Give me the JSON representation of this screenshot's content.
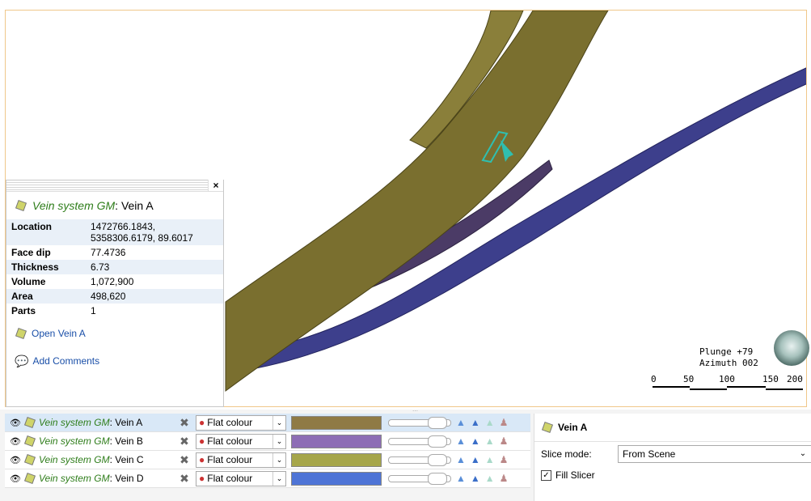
{
  "info_panel": {
    "close": "×",
    "title_italic": "Vein system GM",
    "title_rest": ": Vein A",
    "rows": [
      {
        "k": "Location",
        "v": "1472766.1843,\n5358306.6179, 89.6017"
      },
      {
        "k": "Face dip",
        "v": "77.4736"
      },
      {
        "k": "Thickness",
        "v": "6.73"
      },
      {
        "k": "Volume",
        "v": "1,072,900"
      },
      {
        "k": "Area",
        "v": "498,620"
      },
      {
        "k": "Parts",
        "v": "1"
      }
    ],
    "open_link": "Open Vein A",
    "comments_link": "Add Comments"
  },
  "orientation": {
    "plunge": "Plunge +79",
    "azimuth": "Azimuth 002"
  },
  "scale_bar": {
    "ticks": [
      "0",
      "50",
      "100",
      "150",
      "200"
    ]
  },
  "layers": [
    {
      "group": "Vein system GM",
      "name": ": Vein A",
      "mode": "Flat colour",
      "color": "#8f7a45",
      "selected": true
    },
    {
      "group": "Vein system GM",
      "name": ": Vein B",
      "mode": "Flat colour",
      "color": "#8d6db5",
      "selected": false
    },
    {
      "group": "Vein system GM",
      "name": ": Vein C",
      "mode": "Flat colour",
      "color": "#a6a64a",
      "selected": false
    },
    {
      "group": "Vein system GM",
      "name": ": Vein D",
      "mode": "Flat colour",
      "color": "#4e74d6",
      "selected": false
    }
  ],
  "properties": {
    "title": "Vein A",
    "slice_mode_label": "Slice mode:",
    "slice_mode_value": "From Scene",
    "fill_slicer_label": "Fill Slicer",
    "fill_slicer_checked": true
  }
}
